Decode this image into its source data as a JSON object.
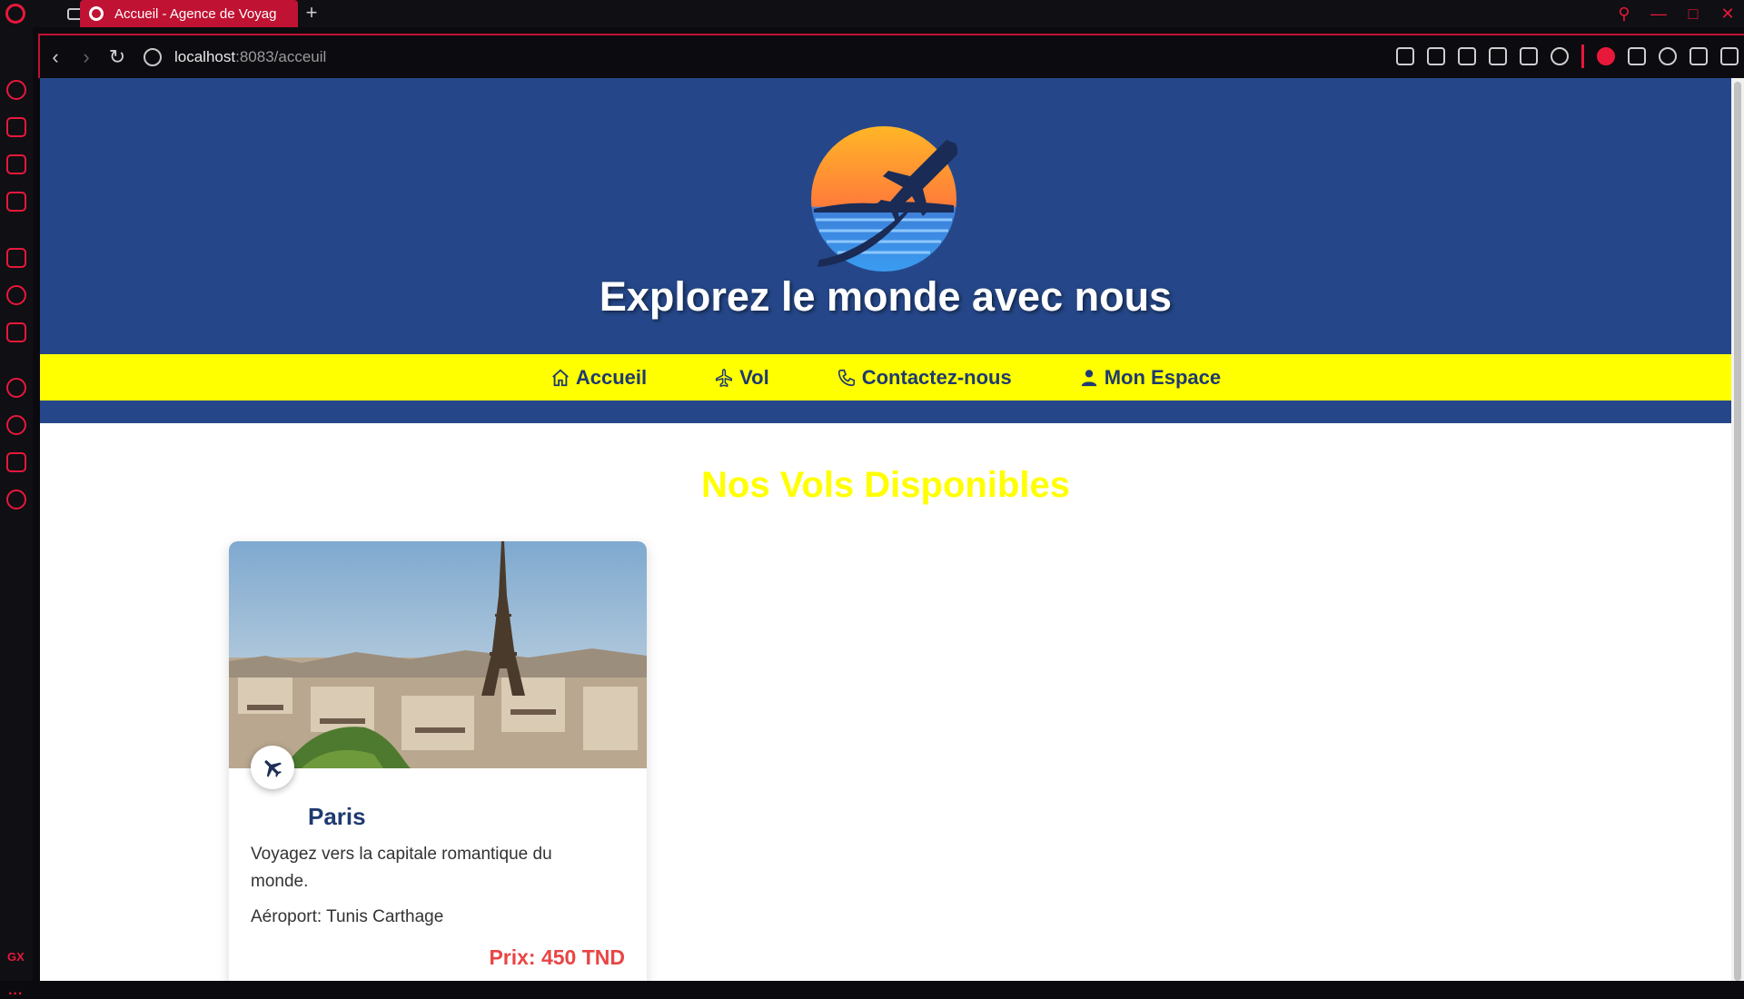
{
  "browser": {
    "tab_title": "Accueil - Agence de Voyag",
    "new_tab": "+",
    "url_host": "localhost",
    "url_path": ":8083/acceuil",
    "accent": "#e8183a",
    "sidebar_badge": "GX",
    "sidebar_more": "..."
  },
  "header": {
    "headline": "Explorez le monde avec nous",
    "background": "#254789"
  },
  "nav": {
    "items": [
      {
        "label": "Accueil",
        "icon": "home-icon"
      },
      {
        "label": "Vol",
        "icon": "plane-icon"
      },
      {
        "label": "Contactez-nous",
        "icon": "phone-icon"
      },
      {
        "label": "Mon Espace",
        "icon": "user-icon"
      }
    ],
    "background": "#ffff00",
    "text_color": "#1e3a70"
  },
  "main": {
    "section_title": "Nos Vols Disponibles",
    "flights": [
      {
        "city": "Paris",
        "description": "Voyagez vers la capitale romantique du monde.",
        "airport": "Aéroport: Tunis Carthage",
        "price": "Prix: 450 TND",
        "image": "eiffel-tower-paris-photo",
        "badge_icon": "plane-icon"
      }
    ],
    "price_color": "#e84545"
  }
}
